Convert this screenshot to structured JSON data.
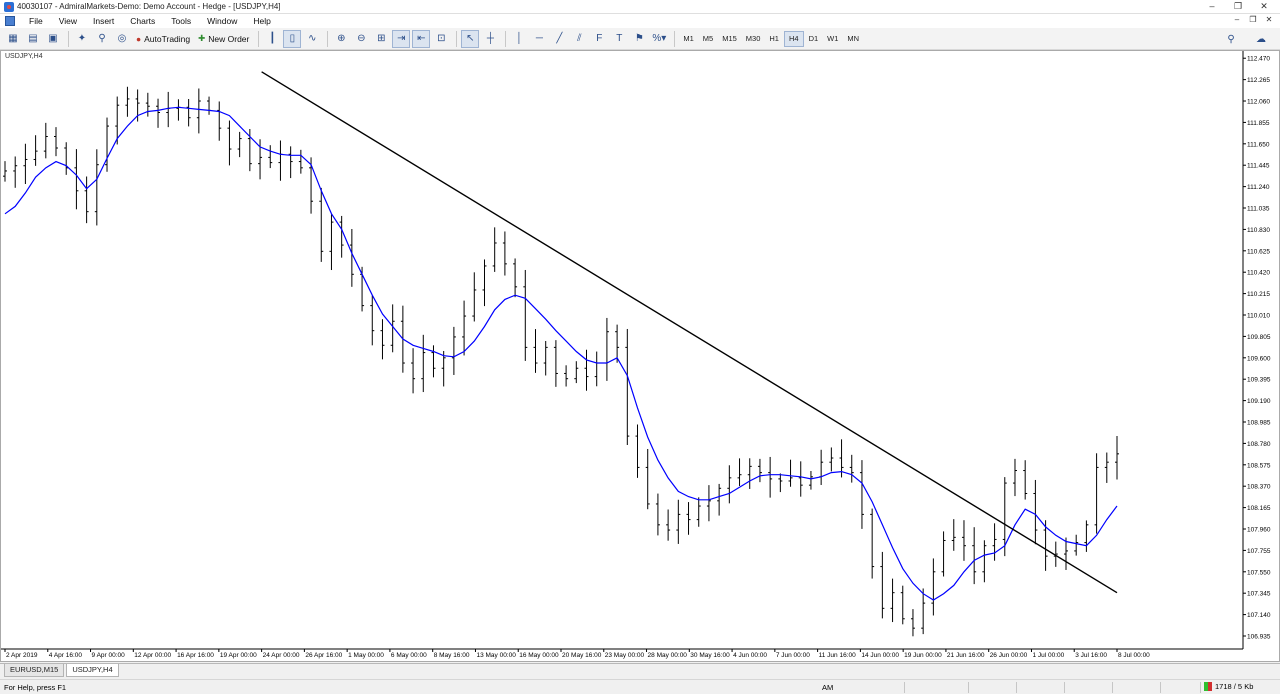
{
  "window": {
    "title": "40030107 - AdmiralMarkets-Demo: Demo Account - Hedge - [USDJPY,H4]",
    "buttons": [
      "–",
      "❐",
      "✕"
    ]
  },
  "menu": {
    "items": [
      "File",
      "View",
      "Insert",
      "Charts",
      "Tools",
      "Window",
      "Help"
    ],
    "mdi_buttons": [
      "–",
      "❐",
      "✕"
    ]
  },
  "toolbar": {
    "autotrading_label": "AutoTrading",
    "new_order_label": "New Order",
    "timeframes": [
      "M1",
      "M5",
      "M15",
      "M30",
      "H1",
      "H4",
      "D1",
      "W1",
      "MN"
    ],
    "active_timeframe": "H4",
    "percent_glyph": "%"
  },
  "chart": {
    "symbol_label": "USDJPY,H4",
    "colors": {
      "bars": "#000000",
      "ma": "#0000ff",
      "trendline": "#000000",
      "background": "#ffffff"
    }
  },
  "chart_data": {
    "type": "line",
    "title": "",
    "y_ticks": [
      "112.470",
      "112.265",
      "112.060",
      "111.855",
      "111.650",
      "111.445",
      "111.240",
      "111.035",
      "110.830",
      "110.625",
      "110.420",
      "110.215",
      "110.010",
      "109.805",
      "109.600",
      "109.395",
      "109.190",
      "108.985",
      "108.780",
      "108.575",
      "108.370",
      "108.165",
      "107.960",
      "107.755",
      "107.550",
      "107.345",
      "107.140",
      "106.935"
    ],
    "x_ticks": [
      "2 Apr 2019",
      "4 Apr 16:00",
      "9 Apr 00:00",
      "12 Apr 00:00",
      "16 Apr 16:00",
      "19 Apr 00:00",
      "24 Apr 00:00",
      "26 Apr 16:00",
      "1 May 00:00",
      "6 May 00:00",
      "8 May 16:00",
      "13 May 00:00",
      "16 May 00:00",
      "20 May 16:00",
      "23 May 00:00",
      "28 May 00:00",
      "30 May 16:00",
      "4 Jun 00:00",
      "7 Jun 00:00",
      "11 Jun 16:00",
      "14 Jun 00:00",
      "19 Jun 00:00",
      "21 Jun 16:00",
      "26 Jun 00:00",
      "1 Jul 00:00",
      "3 Jul 16:00",
      "8 Jul 00:00"
    ],
    "ylim": [
      106.82,
      112.52
    ],
    "series": [
      {
        "values": [
          111.39,
          111.44,
          111.5,
          111.58,
          111.72,
          111.61,
          111.42,
          111.2,
          111.0,
          111.45,
          111.82,
          112.02,
          112.08,
          112.04,
          112.01,
          111.95,
          111.99,
          112.0,
          111.9,
          112.06,
          111.97,
          111.8,
          111.6,
          111.7,
          111.46,
          111.52,
          111.47,
          111.55,
          111.48,
          111.42,
          111.1,
          110.62,
          110.9,
          110.68,
          110.4,
          110.1,
          109.86,
          109.72,
          109.95,
          109.55,
          109.4,
          109.65,
          109.5,
          109.6,
          109.8,
          110.0,
          110.25,
          110.48,
          110.7,
          110.5,
          110.28,
          109.7,
          109.55,
          109.7,
          109.45,
          109.4,
          109.5,
          109.42,
          109.55,
          109.85,
          109.7,
          108.85,
          108.55,
          108.2,
          108.0,
          107.95,
          108.1,
          108.05,
          108.18,
          108.23,
          108.35,
          108.45,
          108.48,
          108.56,
          108.5,
          108.44,
          108.42,
          108.45,
          108.38,
          108.46,
          108.6,
          108.64,
          108.55,
          108.5,
          108.1,
          107.6,
          107.2,
          107.35,
          107.1,
          107.01,
          107.25,
          107.55,
          107.85,
          107.88,
          107.8,
          107.55,
          107.8,
          107.86,
          108.4,
          108.52,
          108.3,
          107.95,
          107.7,
          107.72,
          107.75,
          107.83,
          108.0,
          108.55,
          108.6,
          108.68
        ]
      },
      {
        "values": [
          110.98,
          111.05,
          111.18,
          111.33,
          111.42,
          111.48,
          111.44,
          111.35,
          111.22,
          111.31,
          111.51,
          111.7,
          111.82,
          111.92,
          111.96,
          111.97,
          111.99,
          112.0,
          111.99,
          111.98,
          111.97,
          111.96,
          111.92,
          111.82,
          111.72,
          111.62,
          111.58,
          111.55,
          111.54,
          111.54,
          111.45,
          111.2,
          110.98,
          110.83,
          110.6,
          110.4,
          110.2,
          110.02,
          109.9,
          109.78,
          109.72,
          109.69,
          109.66,
          109.62,
          109.61,
          109.66,
          109.76,
          109.9,
          110.06,
          110.16,
          110.2,
          110.17,
          110.07,
          109.97,
          109.86,
          109.76,
          109.66,
          109.58,
          109.55,
          109.55,
          109.6,
          109.43,
          109.12,
          108.84,
          108.62,
          108.45,
          108.32,
          108.27,
          108.24,
          108.24,
          108.27,
          108.3,
          108.36,
          108.42,
          108.47,
          108.48,
          108.48,
          108.47,
          108.46,
          108.44,
          108.46,
          108.5,
          108.51,
          108.48,
          108.4,
          108.22,
          108.0,
          107.78,
          107.58,
          107.44,
          107.34,
          107.28,
          107.34,
          107.42,
          107.55,
          107.66,
          107.71,
          107.73,
          107.8,
          108.0,
          108.15,
          108.1,
          107.98,
          107.9,
          107.84,
          107.82,
          107.8,
          107.9,
          108.05,
          108.18
        ]
      },
      {
        "x": [
          "24 Apr 00:00",
          "8 Jul 00:00"
        ],
        "values": [
          112.34,
          107.35
        ]
      }
    ]
  },
  "tabs": [
    "EURUSD,M15",
    "USDJPY,H4"
  ],
  "active_tab": "USDJPY,H4",
  "status": {
    "help_text": "For Help, press F1",
    "ampm": "AM",
    "traffic": "1718 / 5 Kb"
  }
}
